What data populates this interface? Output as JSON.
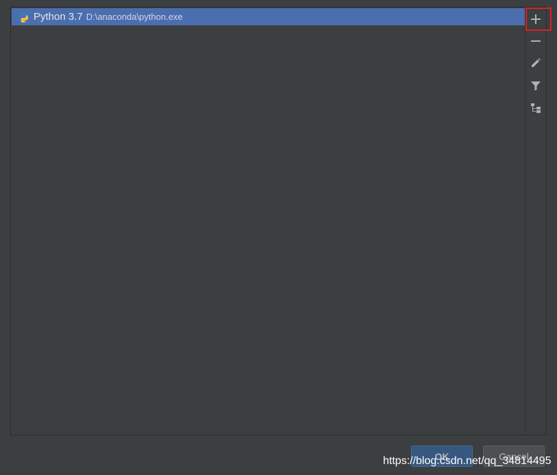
{
  "interpreters": [
    {
      "name": "Python 3.7",
      "path": "D:\\anaconda\\python.exe",
      "selected": true,
      "icon": "python-icon"
    }
  ],
  "toolbar": {
    "add_icon": "plus-icon",
    "remove_icon": "minus-icon",
    "edit_icon": "pencil-icon",
    "filter_icon": "filter-icon",
    "tree_icon": "tree-paths-icon"
  },
  "buttons": {
    "ok_label": "OK",
    "cancel_label": "Cancel"
  },
  "watermark": "https://blog.csdn.net/qq_34814495",
  "colors": {
    "selection": "#4b6eaf",
    "highlight_box": "#e02020",
    "ok_button": "#365880"
  }
}
